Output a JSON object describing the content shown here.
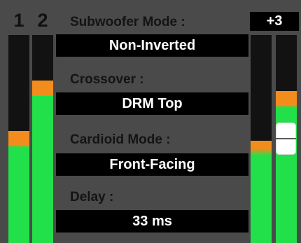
{
  "channels": [
    {
      "label": "1",
      "level": 0.54
    },
    {
      "label": "2",
      "level": 0.78
    }
  ],
  "output_meter": {
    "level": 0.49
  },
  "gain_fader": {
    "value": "+3",
    "level": 0.73
  },
  "settings": [
    {
      "label": "Subwoofer Mode :",
      "value": "Non-Inverted"
    },
    {
      "label": "Crossover :",
      "value": "DRM Top"
    },
    {
      "label": "Cardioid Mode :",
      "value": "Front-Facing"
    },
    {
      "label": "Delay :",
      "value": "33 ms"
    }
  ],
  "colors": {
    "background": "#4a4a4a",
    "meter_track": "#121212",
    "level_green": "#22e04a",
    "level_orange": "#f28c1c",
    "field_bg": "#000000"
  }
}
